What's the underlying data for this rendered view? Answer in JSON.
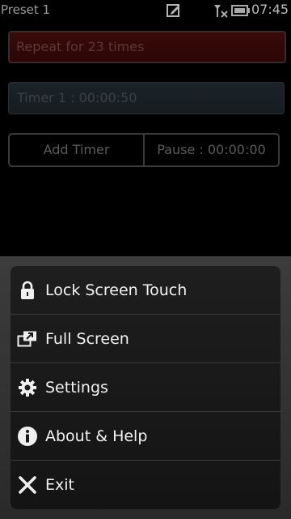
{
  "status_bar": {
    "title": "Preset 1",
    "time": "07:45",
    "icons": [
      "edit-icon",
      "no-signal-icon",
      "battery-icon"
    ]
  },
  "main": {
    "repeat_text": "Repeat for 23 times",
    "timer_text": "Timer 1 : 00:00:50",
    "add_timer_label": "Add Timer",
    "pause_label": "Pause : 00:00:00"
  },
  "menu": {
    "items": [
      {
        "label": "Lock Screen Touch",
        "icon": "lock-icon"
      },
      {
        "label": "Full Screen",
        "icon": "full-screen-icon"
      },
      {
        "label": "Settings",
        "icon": "gear-icon"
      },
      {
        "label": "About & Help",
        "icon": "info-icon"
      },
      {
        "label": "Exit",
        "icon": "close-icon"
      }
    ]
  },
  "colors": {
    "background": "#000000",
    "repeat_field": "#3a0a0a",
    "timer_field": "#1c2328",
    "menu_panel": "#3c3c3c",
    "menu_text": "#f2f2f2"
  }
}
